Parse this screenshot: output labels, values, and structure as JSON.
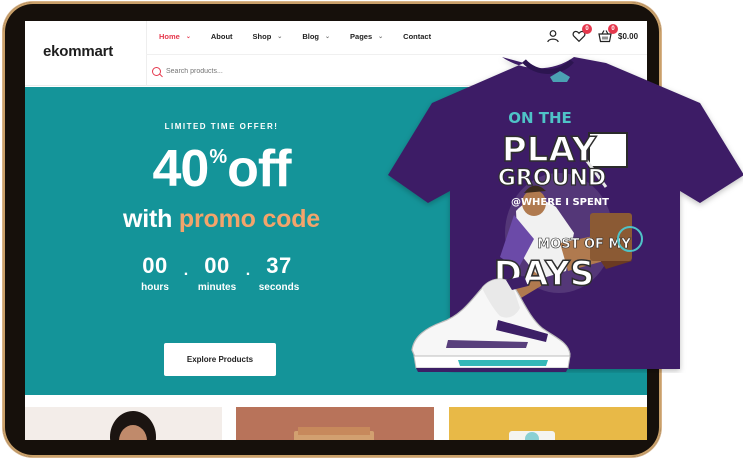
{
  "brand": {
    "logo": "ekommart"
  },
  "nav": [
    {
      "label": "Home",
      "active": true,
      "dropdown": true
    },
    {
      "label": "About",
      "active": false,
      "dropdown": false
    },
    {
      "label": "Shop",
      "active": false,
      "dropdown": true
    },
    {
      "label": "Blog",
      "active": false,
      "dropdown": true
    },
    {
      "label": "Pages",
      "active": false,
      "dropdown": true
    },
    {
      "label": "Contact",
      "active": false,
      "dropdown": false
    }
  ],
  "search": {
    "placeholder": "Search products..."
  },
  "header_icons": {
    "account_icon": "user-icon",
    "wishlist_icon": "heart-icon",
    "wishlist_count": "0",
    "cart_icon": "basket-icon",
    "cart_count": "0",
    "cart_total": "$0.00"
  },
  "hero": {
    "eyebrow": "LIMITED TIME OFFER!",
    "big_number": "40",
    "big_symbol": "%",
    "big_word": "off",
    "line2_prefix": "with ",
    "line2_accent": "promo code",
    "countdown": [
      {
        "value": "00",
        "label": "hours"
      },
      {
        "value": "00",
        "label": "minutes"
      },
      {
        "value": "37",
        "label": "seconds"
      }
    ],
    "cta_label": "Explore Products"
  },
  "tshirt_art": {
    "line1": "ON THE",
    "line2": "PLAY",
    "line3": "GROUND",
    "line4": "@WHERE I SPENT",
    "line5": "MOST OF MY",
    "line6": "DAYS"
  },
  "colors": {
    "accent": "#e5384d",
    "hero_bg": "#149499",
    "promo_accent": "#f3a46b",
    "tshirt": "#3c1f66",
    "frame_gold": "#c9a06a"
  }
}
